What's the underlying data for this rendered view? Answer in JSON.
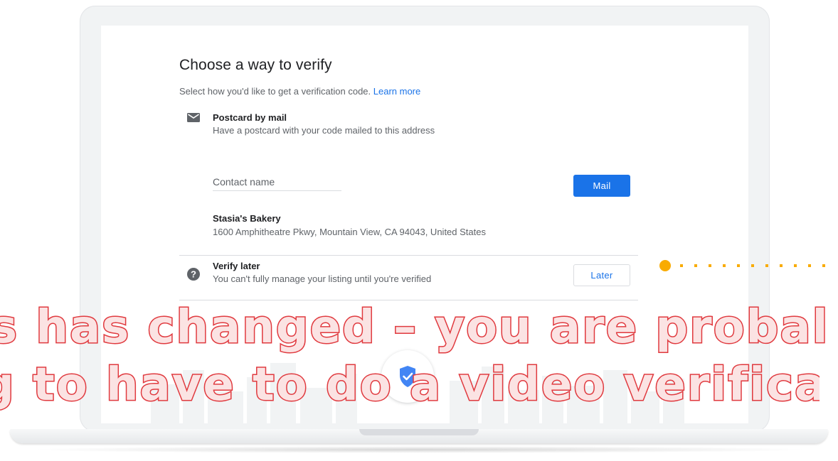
{
  "verify_card": {
    "title": "Choose a way to verify",
    "subtitle": "Select how you'd like to get a verification code.",
    "learn_more_link": "Learn more",
    "options": {
      "postcard": {
        "icon": "mail-icon",
        "title": "Postcard by mail",
        "description": "Have a postcard with your code mailed to this address",
        "contact_name_placeholder": "Contact name",
        "button_label": "Mail",
        "business_name": "Stasia's Bakery",
        "business_address": "1600 Amphitheatre Pkwy, Mountain View, CA 94043, United States"
      },
      "later": {
        "icon": "help-icon",
        "title": "Verify later",
        "description": "You can't fully manage your listing until you're verified",
        "button_label": "Later"
      }
    }
  },
  "overlay": {
    "line1": "s has changed – you are probal",
    "line2": "g to have to do a video verificat"
  },
  "colors": {
    "accent_blue": "#1a73e8",
    "overlay_red": "#e0393e",
    "dot_yellow": "#f9ab00"
  }
}
